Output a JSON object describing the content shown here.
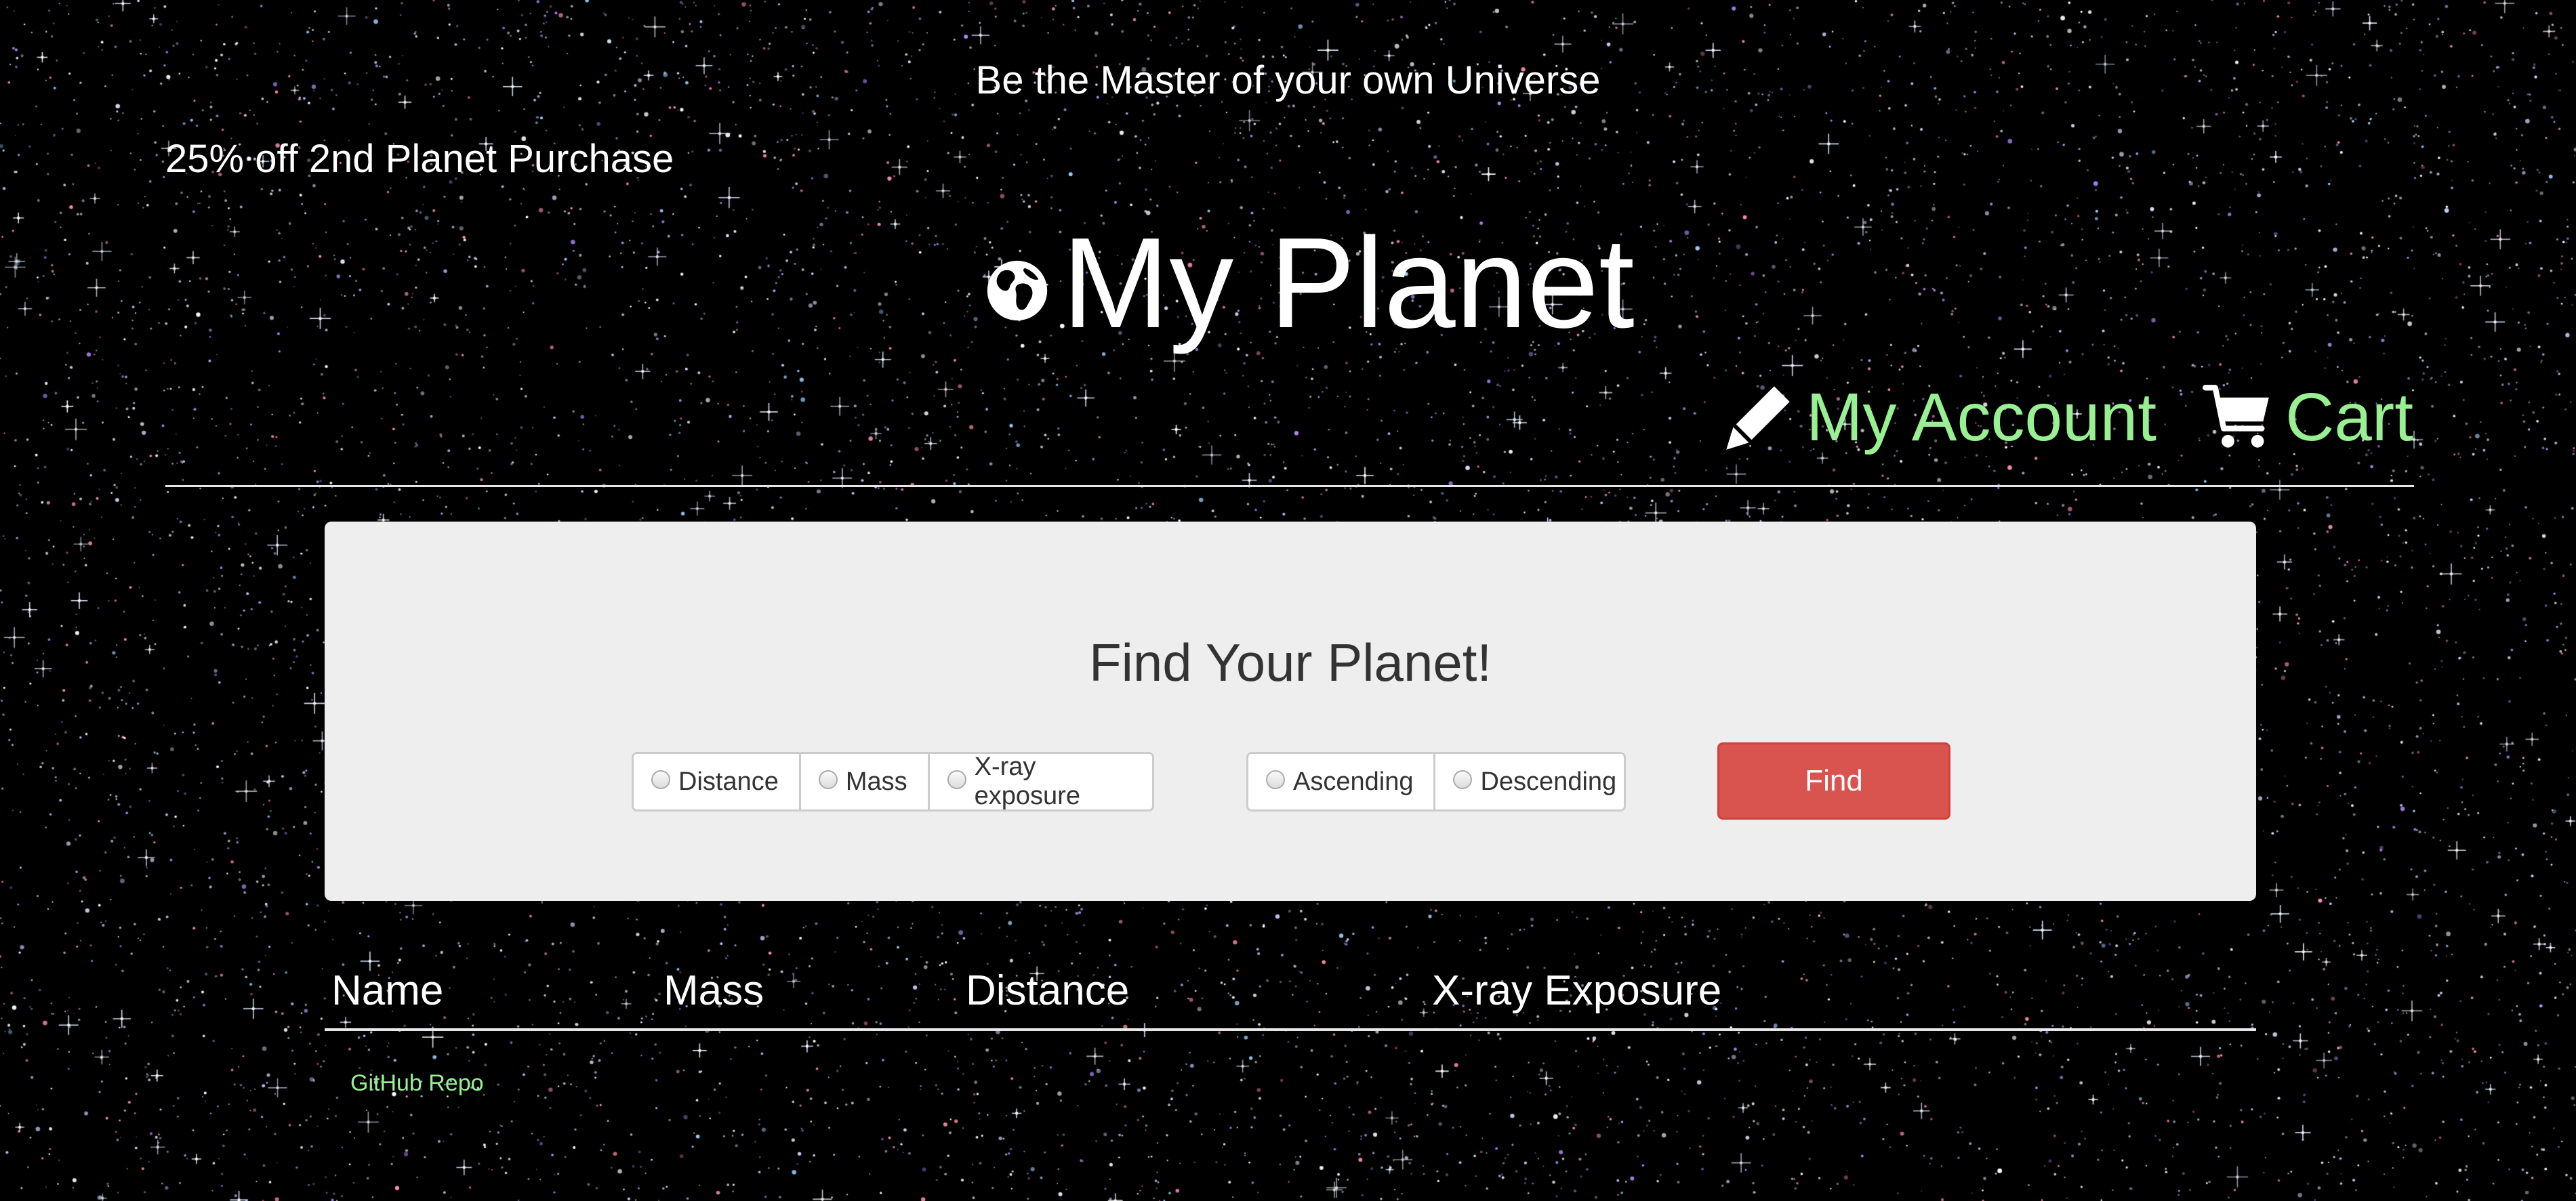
{
  "header": {
    "tagline": "Be the Master of your own Universe",
    "promo": "25% off 2nd Planet Purchase",
    "brand_title": "My Planet",
    "brand_icon": "globe-icon"
  },
  "nav": {
    "account_label": "My Account",
    "account_icon": "pencil-icon",
    "cart_label": "Cart",
    "cart_icon": "shopping-cart-icon",
    "link_color": "#98f092"
  },
  "finder": {
    "title": "Find Your Planet!",
    "sort_by_options": [
      "Distance",
      "Mass",
      "X-ray exposure"
    ],
    "order_options": [
      "Ascending",
      "Descending"
    ],
    "find_label": "Find",
    "find_color": "#d9534f"
  },
  "table": {
    "columns": [
      "Name",
      "Mass",
      "Distance",
      "X-ray Exposure"
    ],
    "rows": []
  },
  "footer": {
    "repo_link": "GitHub Repo"
  }
}
